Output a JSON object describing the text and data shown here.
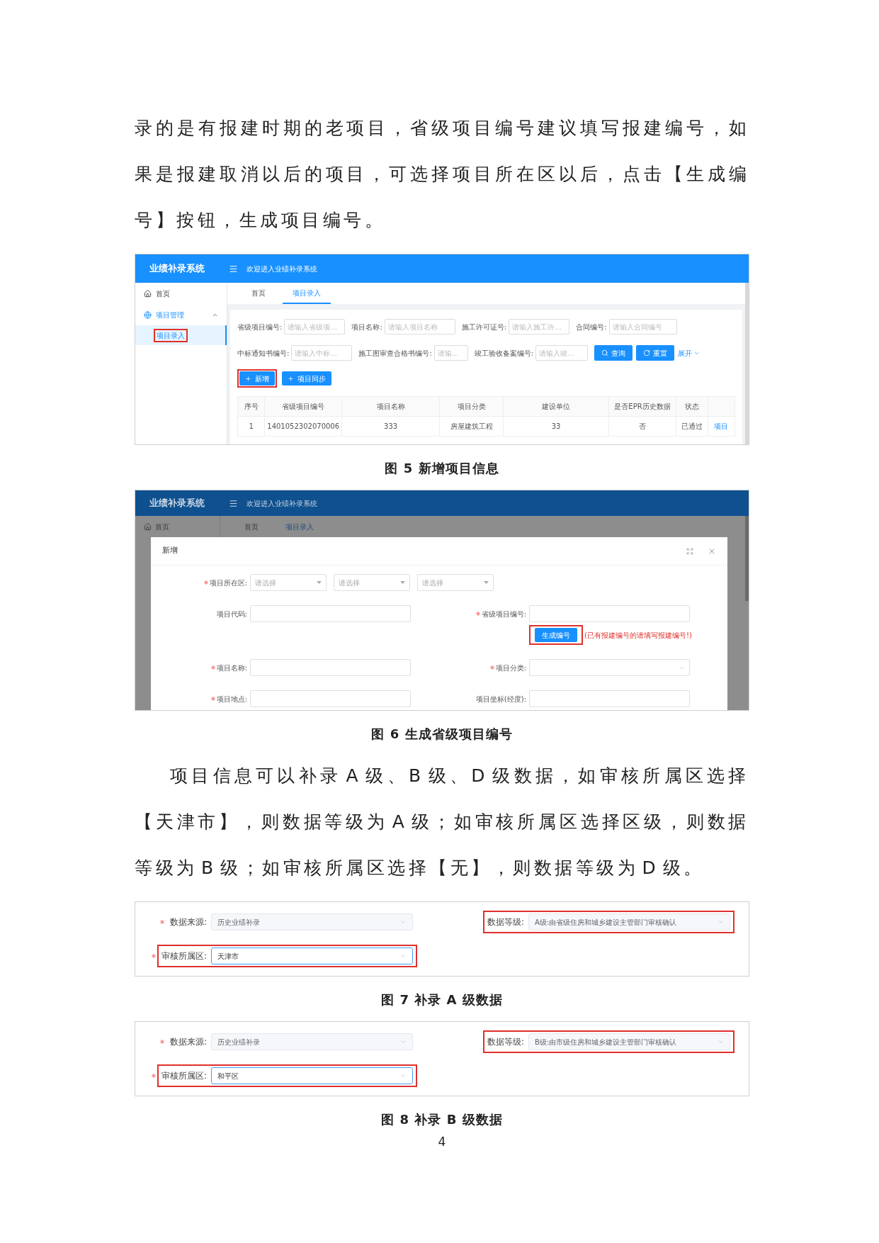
{
  "body": [
    {
      "kind": "paragraph",
      "indent": false,
      "text": "录的是有报建时期的老项目，省级项目编号建议填写报建编号，如果是报建取消以后的项目，可选择项目所在区以后，点击【生成编号】按钮，生成项目编号。"
    },
    {
      "kind": "list_screen",
      "app_title": "业绩补录系统",
      "header_text": "欢迎进入业绩补录系统",
      "sidebar": [
        {
          "label": "首页"
        },
        {
          "label": "项目管理",
          "expanded": true,
          "children": [
            {
              "label": "项目录入",
              "selected": true,
              "highlighted": true
            }
          ]
        }
      ],
      "tabs": [
        {
          "label": "首页",
          "selected": false
        },
        {
          "label": "项目录入",
          "selected": true
        }
      ],
      "filters": [
        [
          {
            "label": "省级项目编号:",
            "placeholder": "请输入省级项..."
          },
          {
            "label": "项目名称:",
            "placeholder": "请输入项目名称"
          },
          {
            "label": "施工许可证号:",
            "placeholder": "请输入施工许..."
          },
          {
            "label": "合同编号:",
            "placeholder": "请输入合同编号"
          }
        ],
        [
          {
            "label": "中标通知书编号:",
            "placeholder": "请输入中标..."
          },
          {
            "label": "施工图审查合格书编号:",
            "placeholder": "请输..."
          },
          {
            "label": "竣工验收备案编号:",
            "placeholder": "请输入竣..."
          }
        ]
      ],
      "search_buttons": [
        {
          "label": "查询",
          "kind": "search"
        },
        {
          "label": "重置",
          "kind": "reset"
        }
      ],
      "expand_link": "展开",
      "actions": [
        {
          "label": "新增",
          "highlighted": true
        },
        {
          "label": "项目同步",
          "highlighted": false
        }
      ],
      "table": {
        "columns": [
          "序号",
          "省级项目编号",
          "项目名称",
          "项目分类",
          "建设单位",
          "是否EPR历史数据",
          "状态"
        ],
        "rows": [
          {
            "cells": [
              "1",
              "1401052302070006",
              "333",
              "房屋建筑工程",
              "33",
              "否",
              "已通过"
            ],
            "link": "项目"
          }
        ]
      }
    },
    {
      "kind": "caption",
      "text": "图 5 新增项目信息"
    },
    {
      "kind": "dialog_screen",
      "app_title": "业绩补录系统",
      "header_text": "欢迎进入业绩补录系统",
      "sidebar": [
        {
          "label": "首页"
        }
      ],
      "tabs": [
        {
          "label": "首页",
          "selected": false
        },
        {
          "label": "项目录入",
          "selected": true
        }
      ],
      "dialog": {
        "title": "新增",
        "fields": [
          {
            "kind": "region",
            "label": "项目所在区:",
            "required": true,
            "placeholders": [
              "请选择",
              "请选择",
              "请选择"
            ]
          },
          {
            "kind": "input",
            "label": "项目代码:",
            "required": false
          },
          {
            "kind": "input",
            "label": "省级项目编号:",
            "required": true,
            "action": {
              "label": "生成编号",
              "highlighted": true
            },
            "note": "(已有报建编号的请填写报建编号!)"
          },
          {
            "kind": "input",
            "label": "项目名称:",
            "required": true
          },
          {
            "kind": "select",
            "label": "项目分类:",
            "required": true
          },
          {
            "kind": "input",
            "label": "项目地点:",
            "required": true
          },
          {
            "kind": "input",
            "label": "项目坐标(经度):",
            "required": false
          }
        ]
      }
    },
    {
      "kind": "caption",
      "text": "图 6 生成省级项目编号"
    },
    {
      "kind": "paragraph",
      "indent": true,
      "text": "项目信息可以补录 A 级、B 级、D 级数据，如审核所属区选择【天津市】，则数据等级为 A 级；如审核所属区选择区级，则数据等级为 B 级；如审核所属区选择【无】，则数据等级为 D 级。"
    },
    {
      "kind": "level_form",
      "rows": [
        {
          "fields": [
            {
              "label": "数据来源:",
              "required": true,
              "value": "历史业绩补录",
              "disabled": true,
              "focused": false,
              "highlighted": false
            },
            {
              "label": "数据等级:",
              "required": false,
              "value": "A级:由省级住房和城乡建设主管部门审核确认",
              "disabled": true,
              "focused": false,
              "highlighted": true
            }
          ]
        },
        {
          "fields": [
            {
              "label": "审核所属区:",
              "required": true,
              "value": "天津市",
              "disabled": false,
              "focused": true,
              "highlighted": true
            }
          ]
        }
      ]
    },
    {
      "kind": "caption",
      "text": "图 7 补录 A 级数据"
    },
    {
      "kind": "level_form",
      "rows": [
        {
          "fields": [
            {
              "label": "数据来源:",
              "required": true,
              "value": "历史业绩补录",
              "disabled": true,
              "focused": false,
              "highlighted": false
            },
            {
              "label": "数据等级:",
              "required": false,
              "value": "B级:由市级住房和城乡建设主管部门审核确认",
              "disabled": true,
              "focused": false,
              "highlighted": true
            }
          ]
        },
        {
          "fields": [
            {
              "label": "审核所属区:",
              "required": true,
              "value": "和平区",
              "disabled": false,
              "focused": true,
              "highlighted": true
            }
          ]
        }
      ]
    },
    {
      "kind": "caption",
      "text": "图 8 补录 B 级数据"
    }
  ],
  "page_number": "4"
}
